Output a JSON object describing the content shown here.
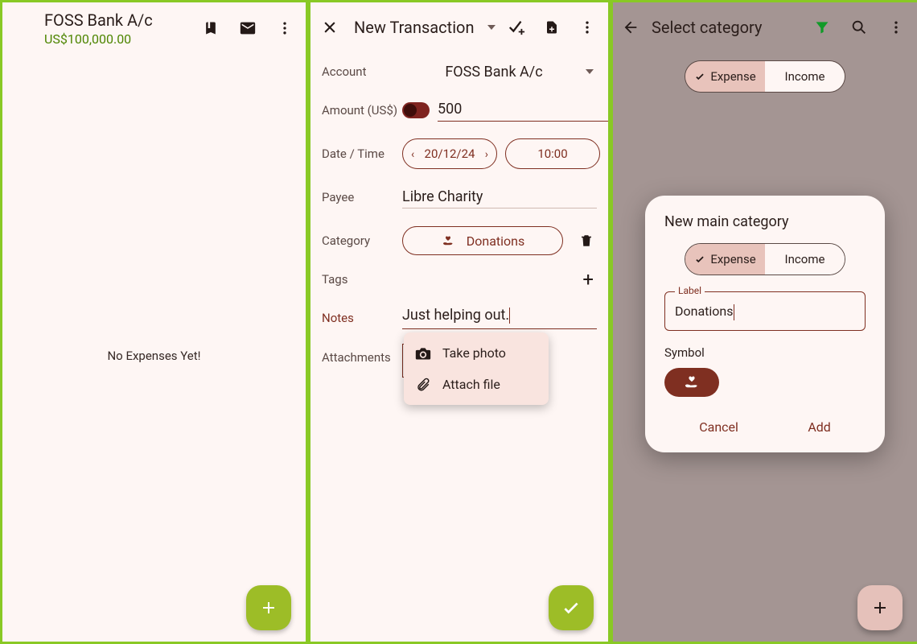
{
  "panel1": {
    "account_name": "FOSS Bank A/c",
    "balance": "US$100,000.00",
    "empty": "No Expenses Yet!"
  },
  "panel2": {
    "title": "New Transaction",
    "labels": {
      "account": "Account",
      "amount": "Amount (US$)",
      "datetime": "Date / Time",
      "payee": "Payee",
      "category": "Category",
      "tags": "Tags",
      "notes": "Notes",
      "attachments": "Attachments"
    },
    "account_value": "FOSS Bank A/c",
    "amount_value": "500",
    "date_value": "20/12/24",
    "time_value": "10:00",
    "payee_value": "Libre Charity",
    "category_value": "Donations",
    "notes_value": "Just helping out.",
    "popup": {
      "take_photo": "Take photo",
      "attach_file": "Attach file"
    }
  },
  "panel3": {
    "title": "Select category",
    "seg_expense": "Expense",
    "seg_income": "Income",
    "dialog": {
      "title": "New main category",
      "seg_expense": "Expense",
      "seg_income": "Income",
      "label_legend": "Label",
      "label_value": "Donations",
      "symbol_label": "Symbol",
      "cancel": "Cancel",
      "add": "Add"
    }
  }
}
